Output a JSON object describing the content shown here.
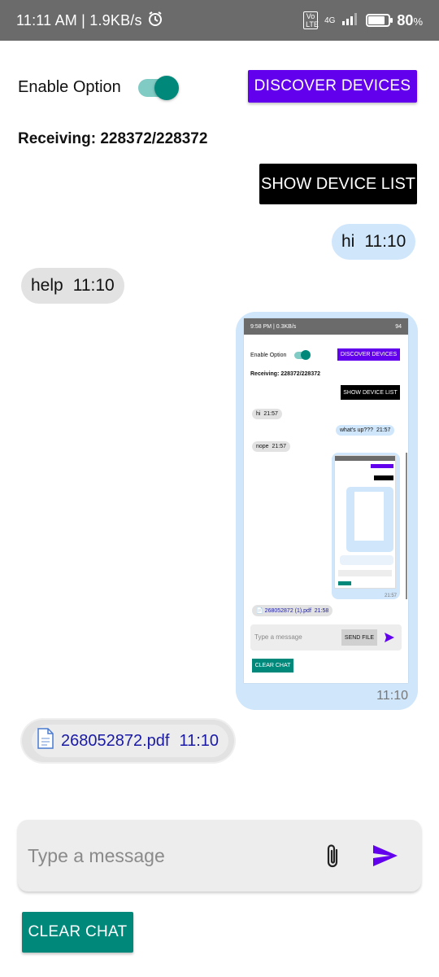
{
  "status_bar": {
    "time": "11:11 AM | 1.9KB/s",
    "network": "4G",
    "volte": "Vo LTE",
    "battery": "80",
    "battery_unit": "%",
    "battery_level": 0.8
  },
  "controls": {
    "enable_label": "Enable Option",
    "toggle_on": true,
    "discover_label": "DISCOVER DEVICES",
    "receiving": "Receiving: 228372/228372",
    "device_list_label": "SHOW DEVICE LIST"
  },
  "messages": [
    {
      "text": "hi",
      "time": "11:10",
      "side": "sent"
    },
    {
      "text": "help",
      "time": "11:10",
      "side": "received"
    }
  ],
  "image_message": {
    "time": "11:10",
    "inner": {
      "status": "9:58 PM | 0.3KB/s",
      "battery": "94",
      "enable_label": "Enable Option",
      "discover_label": "DISCOVER DEVICES",
      "receiving": "Receiving: 228372/228372",
      "device_list_label": "SHOW DEVICE LIST",
      "msg1_text": "hi",
      "msg1_time": "21:57",
      "msg2_text": "what's up???",
      "msg2_time": "21:57",
      "msg3_text": "nope",
      "msg3_time": "21:57",
      "nested_time": "21:57",
      "file_name": "268052872 (1).pdf",
      "file_time": "21:58",
      "placeholder": "Type a message",
      "send_file_label": "SEND FILE",
      "clear_label": "CLEAR CHAT"
    }
  },
  "file_message": {
    "file_name": "268052872.pdf",
    "time": "11:10",
    "icon": "document-icon"
  },
  "composer": {
    "placeholder": "Type a message",
    "attach_icon": "paperclip-icon",
    "send_icon": "send-icon"
  },
  "clear_label": "CLEAR CHAT",
  "colors": {
    "accent": "#6200ee",
    "teal": "#00897b",
    "sent_bubble": "#cfe6fb",
    "received_bubble": "#e2e2e2"
  }
}
